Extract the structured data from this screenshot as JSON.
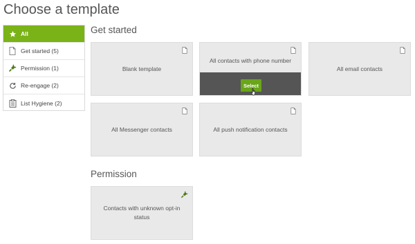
{
  "page": {
    "title": "Choose a template"
  },
  "sidebar": {
    "items": [
      {
        "label": "All",
        "icon": "star-icon",
        "active": true
      },
      {
        "label": "Get started (5)",
        "icon": "document-icon"
      },
      {
        "label": "Permission (1)",
        "icon": "plug-icon"
      },
      {
        "label": "Re-engage (2)",
        "icon": "refresh-icon"
      },
      {
        "label": "List Hygiene (2)",
        "icon": "list-icon"
      }
    ]
  },
  "sections": {
    "get_started": {
      "title": "Get started",
      "cards": [
        {
          "label": "Blank template",
          "icon": "document-icon"
        },
        {
          "label": "All contacts with phone number",
          "icon": "document-icon",
          "button": "Select"
        },
        {
          "label": "All email contacts",
          "icon": "document-icon"
        },
        {
          "label": "All Messenger contacts",
          "icon": "document-icon"
        },
        {
          "label": "All push notification contacts",
          "icon": "document-icon"
        }
      ]
    },
    "permission": {
      "title": "Permission",
      "cards": [
        {
          "label": "Contacts with unknown opt-in status",
          "icon": "plug-icon"
        }
      ]
    }
  },
  "colors": {
    "accent": "#7ab317",
    "button": "#6aa51a",
    "card_bg": "#e9e9e9",
    "overlay": "#555555"
  }
}
